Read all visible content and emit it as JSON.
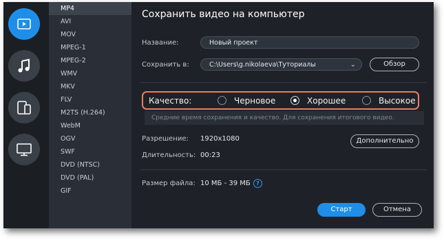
{
  "formats": [
    "MP4",
    "AVI",
    "MOV",
    "MPEG-1",
    "MPEG-2",
    "WMV",
    "MKV",
    "FLV",
    "M2TS (H.264)",
    "WebM",
    "OGV",
    "SWF",
    "DVD (NTSC)",
    "DVD (PAL)",
    "GIF"
  ],
  "selected_format": "MP4",
  "dialog": {
    "title": "Сохранить видео на компьютер",
    "name_label": "Название:",
    "name_value": "Новый проект",
    "save_to_label": "Сохранить в:",
    "save_to_value": "C:\\Users\\g.nikolaeva\\Туториалы",
    "browse_button": "Обзор",
    "quality_label": "Качество:",
    "quality_options": [
      "Черновое",
      "Хорошее",
      "Высокое"
    ],
    "quality_selected": "Хорошее",
    "quality_hint": "Средние время сохранения и качество. Для сохранения итогового видео.",
    "resolution_label": "Разрешение:",
    "resolution_value": "1920x1080",
    "advanced_button": "Дополнительно",
    "duration_label": "Длительность:",
    "duration_value": "00:23",
    "filesize_label": "Размер файла:",
    "filesize_value": "10 МБ - 39 МБ",
    "help_glyph": "?",
    "start_button": "Старт",
    "cancel_button": "Отмена"
  },
  "rail_icons": [
    "video-icon",
    "music-icon",
    "devices-icon",
    "monitor-icon"
  ],
  "colors": {
    "accent": "#1f8ee8",
    "highlight": "#f07b62",
    "window_bg": "#1e2228"
  }
}
